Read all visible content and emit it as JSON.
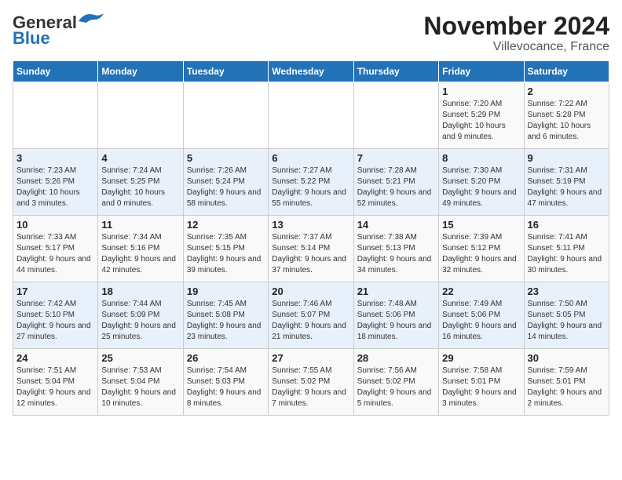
{
  "header": {
    "logo_general": "General",
    "logo_blue": "Blue",
    "month_title": "November 2024",
    "location": "Villevocance, France"
  },
  "weekdays": [
    "Sunday",
    "Monday",
    "Tuesday",
    "Wednesday",
    "Thursday",
    "Friday",
    "Saturday"
  ],
  "weeks": [
    [
      null,
      null,
      null,
      null,
      null,
      {
        "day": "1",
        "sunrise": "Sunrise: 7:20 AM",
        "sunset": "Sunset: 5:29 PM",
        "daylight": "Daylight: 10 hours and 9 minutes."
      },
      {
        "day": "2",
        "sunrise": "Sunrise: 7:22 AM",
        "sunset": "Sunset: 5:28 PM",
        "daylight": "Daylight: 10 hours and 6 minutes."
      }
    ],
    [
      {
        "day": "3",
        "sunrise": "Sunrise: 7:23 AM",
        "sunset": "Sunset: 5:26 PM",
        "daylight": "Daylight: 10 hours and 3 minutes."
      },
      {
        "day": "4",
        "sunrise": "Sunrise: 7:24 AM",
        "sunset": "Sunset: 5:25 PM",
        "daylight": "Daylight: 10 hours and 0 minutes."
      },
      {
        "day": "5",
        "sunrise": "Sunrise: 7:26 AM",
        "sunset": "Sunset: 5:24 PM",
        "daylight": "Daylight: 9 hours and 58 minutes."
      },
      {
        "day": "6",
        "sunrise": "Sunrise: 7:27 AM",
        "sunset": "Sunset: 5:22 PM",
        "daylight": "Daylight: 9 hours and 55 minutes."
      },
      {
        "day": "7",
        "sunrise": "Sunrise: 7:28 AM",
        "sunset": "Sunset: 5:21 PM",
        "daylight": "Daylight: 9 hours and 52 minutes."
      },
      {
        "day": "8",
        "sunrise": "Sunrise: 7:30 AM",
        "sunset": "Sunset: 5:20 PM",
        "daylight": "Daylight: 9 hours and 49 minutes."
      },
      {
        "day": "9",
        "sunrise": "Sunrise: 7:31 AM",
        "sunset": "Sunset: 5:19 PM",
        "daylight": "Daylight: 9 hours and 47 minutes."
      }
    ],
    [
      {
        "day": "10",
        "sunrise": "Sunrise: 7:33 AM",
        "sunset": "Sunset: 5:17 PM",
        "daylight": "Daylight: 9 hours and 44 minutes."
      },
      {
        "day": "11",
        "sunrise": "Sunrise: 7:34 AM",
        "sunset": "Sunset: 5:16 PM",
        "daylight": "Daylight: 9 hours and 42 minutes."
      },
      {
        "day": "12",
        "sunrise": "Sunrise: 7:35 AM",
        "sunset": "Sunset: 5:15 PM",
        "daylight": "Daylight: 9 hours and 39 minutes."
      },
      {
        "day": "13",
        "sunrise": "Sunrise: 7:37 AM",
        "sunset": "Sunset: 5:14 PM",
        "daylight": "Daylight: 9 hours and 37 minutes."
      },
      {
        "day": "14",
        "sunrise": "Sunrise: 7:38 AM",
        "sunset": "Sunset: 5:13 PM",
        "daylight": "Daylight: 9 hours and 34 minutes."
      },
      {
        "day": "15",
        "sunrise": "Sunrise: 7:39 AM",
        "sunset": "Sunset: 5:12 PM",
        "daylight": "Daylight: 9 hours and 32 minutes."
      },
      {
        "day": "16",
        "sunrise": "Sunrise: 7:41 AM",
        "sunset": "Sunset: 5:11 PM",
        "daylight": "Daylight: 9 hours and 30 minutes."
      }
    ],
    [
      {
        "day": "17",
        "sunrise": "Sunrise: 7:42 AM",
        "sunset": "Sunset: 5:10 PM",
        "daylight": "Daylight: 9 hours and 27 minutes."
      },
      {
        "day": "18",
        "sunrise": "Sunrise: 7:44 AM",
        "sunset": "Sunset: 5:09 PM",
        "daylight": "Daylight: 9 hours and 25 minutes."
      },
      {
        "day": "19",
        "sunrise": "Sunrise: 7:45 AM",
        "sunset": "Sunset: 5:08 PM",
        "daylight": "Daylight: 9 hours and 23 minutes."
      },
      {
        "day": "20",
        "sunrise": "Sunrise: 7:46 AM",
        "sunset": "Sunset: 5:07 PM",
        "daylight": "Daylight: 9 hours and 21 minutes."
      },
      {
        "day": "21",
        "sunrise": "Sunrise: 7:48 AM",
        "sunset": "Sunset: 5:06 PM",
        "daylight": "Daylight: 9 hours and 18 minutes."
      },
      {
        "day": "22",
        "sunrise": "Sunrise: 7:49 AM",
        "sunset": "Sunset: 5:06 PM",
        "daylight": "Daylight: 9 hours and 16 minutes."
      },
      {
        "day": "23",
        "sunrise": "Sunrise: 7:50 AM",
        "sunset": "Sunset: 5:05 PM",
        "daylight": "Daylight: 9 hours and 14 minutes."
      }
    ],
    [
      {
        "day": "24",
        "sunrise": "Sunrise: 7:51 AM",
        "sunset": "Sunset: 5:04 PM",
        "daylight": "Daylight: 9 hours and 12 minutes."
      },
      {
        "day": "25",
        "sunrise": "Sunrise: 7:53 AM",
        "sunset": "Sunset: 5:04 PM",
        "daylight": "Daylight: 9 hours and 10 minutes."
      },
      {
        "day": "26",
        "sunrise": "Sunrise: 7:54 AM",
        "sunset": "Sunset: 5:03 PM",
        "daylight": "Daylight: 9 hours and 8 minutes."
      },
      {
        "day": "27",
        "sunrise": "Sunrise: 7:55 AM",
        "sunset": "Sunset: 5:02 PM",
        "daylight": "Daylight: 9 hours and 7 minutes."
      },
      {
        "day": "28",
        "sunrise": "Sunrise: 7:56 AM",
        "sunset": "Sunset: 5:02 PM",
        "daylight": "Daylight: 9 hours and 5 minutes."
      },
      {
        "day": "29",
        "sunrise": "Sunrise: 7:58 AM",
        "sunset": "Sunset: 5:01 PM",
        "daylight": "Daylight: 9 hours and 3 minutes."
      },
      {
        "day": "30",
        "sunrise": "Sunrise: 7:59 AM",
        "sunset": "Sunset: 5:01 PM",
        "daylight": "Daylight: 9 hours and 2 minutes."
      }
    ]
  ]
}
